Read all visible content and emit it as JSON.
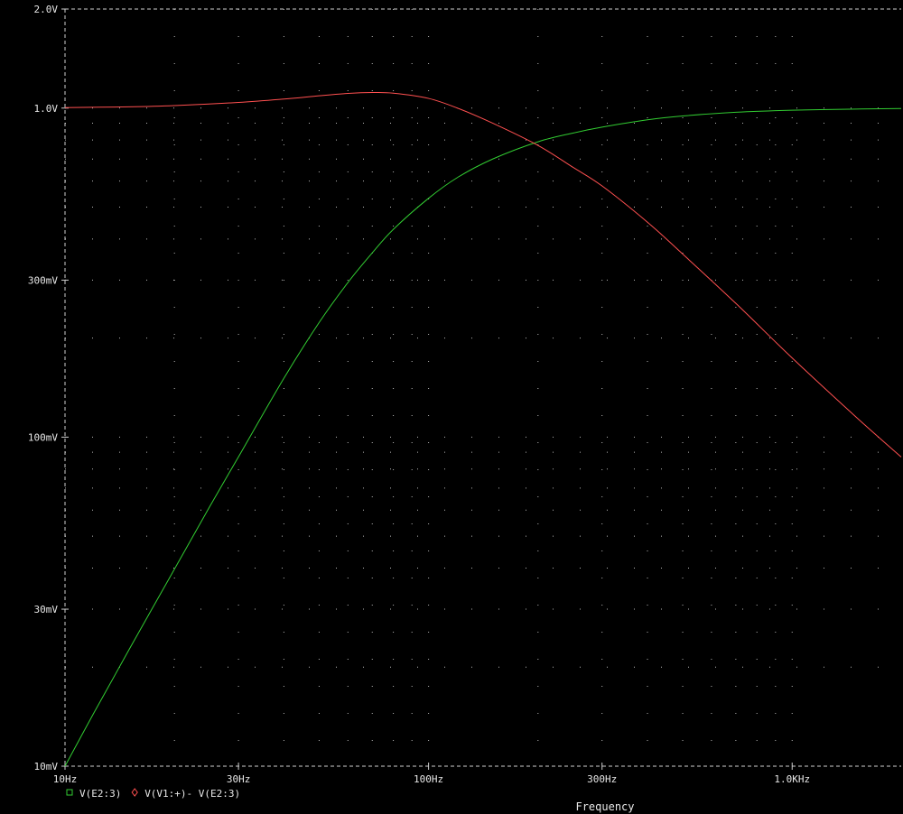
{
  "chart_data": {
    "type": "line",
    "xlabel": "Frequency",
    "x_scale": "log",
    "y_scale": "log",
    "xlim": [
      10,
      1995
    ],
    "ylim": [
      0.01,
      2.0
    ],
    "x_ticks": [
      {
        "value": 10,
        "label": "10Hz"
      },
      {
        "value": 30,
        "label": "30Hz"
      },
      {
        "value": 100,
        "label": "100Hz"
      },
      {
        "value": 300,
        "label": "300Hz"
      },
      {
        "value": 1000,
        "label": "1.0KHz"
      }
    ],
    "y_ticks": [
      {
        "value": 2.0,
        "label": "2.0V"
      },
      {
        "value": 1.0,
        "label": "1.0V"
      },
      {
        "value": 0.3,
        "label": "300mV"
      },
      {
        "value": 0.1,
        "label": "100mV"
      },
      {
        "value": 0.03,
        "label": "30mV"
      },
      {
        "value": 0.01,
        "label": "10mV"
      }
    ],
    "grid": true,
    "legend_position": "bottom-left",
    "series": [
      {
        "name": "V(E2:3)",
        "color": "#32cd32",
        "marker": "square",
        "x": [
          10,
          12,
          15,
          20,
          25,
          30,
          40,
          50,
          60,
          70,
          80,
          100,
          120,
          150,
          200,
          250,
          300,
          400,
          500,
          700,
          1000,
          1500,
          1995
        ],
        "y": [
          0.01,
          0.0145,
          0.0226,
          0.0397,
          0.0615,
          0.0871,
          0.151,
          0.223,
          0.295,
          0.363,
          0.428,
          0.532,
          0.615,
          0.7,
          0.79,
          0.84,
          0.875,
          0.921,
          0.946,
          0.971,
          0.985,
          0.993,
          0.997
        ]
      },
      {
        "name": "V(V1:+)- V(E2:3)",
        "color": "#ff5050",
        "marker": "diamond",
        "x": [
          10,
          15,
          20,
          30,
          40,
          50,
          60,
          70,
          80,
          100,
          120,
          150,
          200,
          250,
          300,
          400,
          500,
          700,
          1000,
          1500,
          1995
        ],
        "y": [
          1.003,
          1.009,
          1.018,
          1.04,
          1.065,
          1.09,
          1.108,
          1.115,
          1.11,
          1.07,
          1.0,
          0.9,
          0.77,
          0.66,
          0.58,
          0.45,
          0.36,
          0.255,
          0.174,
          0.115,
          0.087
        ]
      }
    ]
  }
}
